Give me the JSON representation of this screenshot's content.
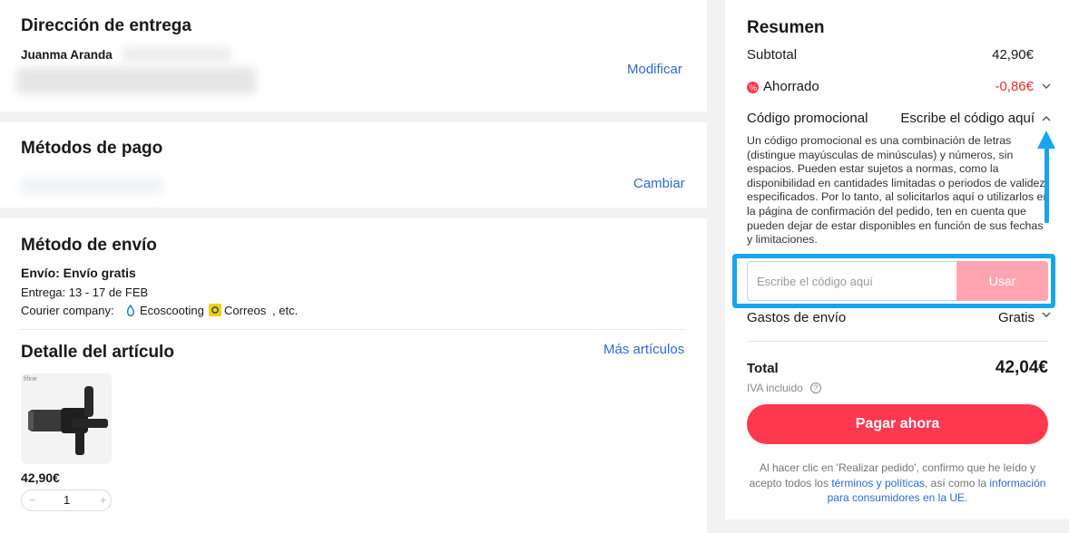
{
  "address": {
    "title": "Dirección de entrega",
    "name": "Juanma Aranda",
    "modify_link": "Modificar"
  },
  "payment": {
    "title": "Métodos de pago",
    "change_link": "Cambiar"
  },
  "shipping": {
    "title": "Método de envío",
    "method": "Envío: Envío gratis",
    "delivery": "Entrega: 13 - 17 de FEB",
    "courier_label": "Courier company:",
    "courier_1": "Ecoscooting",
    "courier_2": "Correos",
    "courier_suffix": ", etc."
  },
  "items": {
    "title": "Detalle del artículo",
    "more_link": "Más artículos",
    "product": {
      "brand": "fifine",
      "price": "42,90€",
      "quantity": "1",
      "minus": "−",
      "plus": "+"
    }
  },
  "summary": {
    "title": "Resumen",
    "subtotal_label": "Subtotal",
    "subtotal_value": "42,90€",
    "saved_label": "Ahorrado",
    "saved_value": "-0,86€",
    "promo_label": "Código promocional",
    "promo_prompt": "Escribe el código aquí",
    "promo_description": "Un código promocional es una combinación de letras (distingue mayúsculas de minúsculas) y números, sin espacios. Pueden estar sujetos a normas, como la disponibilidad en cantidades limitadas o periodos de validez especificados. Por lo tanto, al solicitarlos aquí o utilizarlos en la página de confirmación del pedido, ten en cuenta que pueden dejar de estar disponibles en función de sus fechas y limitaciones.",
    "promo_placeholder": "Escribe el código aquí",
    "promo_button": "Usar",
    "shipping_label": "Gastos de envío",
    "shipping_value": "Gratis",
    "total_label": "Total",
    "total_value": "42,04€",
    "vat_note": "IVA incluido",
    "pay_button": "Pagar ahora",
    "legal_1": "Al hacer clic en 'Realizar pedido', confirmo que he leído y acepto todos los ",
    "legal_link_1": "términos y políticas",
    "legal_2": ", así como la ",
    "legal_link_2": "información para consumidores en la UE",
    "legal_3": "."
  },
  "colors": {
    "accent_red": "#fd384f",
    "link_blue": "#2c6ad6",
    "highlight_blue": "#17a5ef",
    "saved_red": "#e62e2e"
  },
  "icons": {
    "saved": "discount-badge-icon",
    "chevron": "chevron-icon",
    "info": "info-icon"
  }
}
